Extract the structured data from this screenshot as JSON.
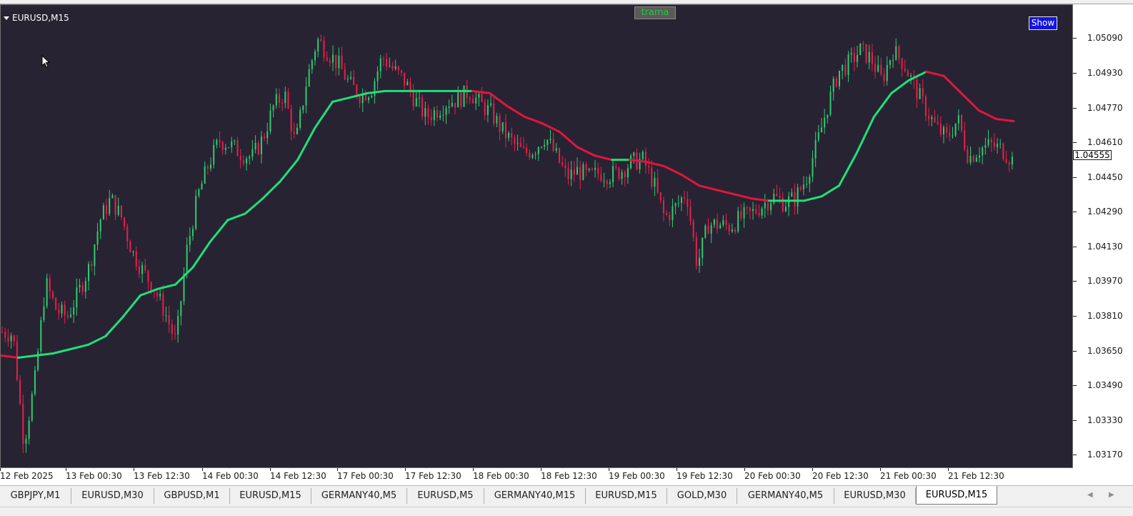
{
  "chart": {
    "symbol_title": "EURUSD,M15",
    "indicator_label": "trama",
    "show_button": "Show",
    "current_price": "1.04555",
    "colors": {
      "background": "#282332",
      "bull": "#2ecc71",
      "bear": "#e8204a",
      "ma_up": "#1ee07a",
      "ma_down": "#e0163f",
      "trama_text": "#21c93a",
      "show_bg": "#1414e0"
    }
  },
  "price_axis": [
    "1.05090",
    "1.04930",
    "1.04770",
    "1.04610",
    "1.04450",
    "1.04290",
    "1.04130",
    "1.03970",
    "1.03810",
    "1.03650",
    "1.03490",
    "1.03330",
    "1.03170"
  ],
  "time_axis": [
    "12 Feb 2025",
    "13 Feb 00:30",
    "13 Feb 12:30",
    "14 Feb 00:30",
    "14 Feb 12:30",
    "17 Feb 00:30",
    "17 Feb 12:30",
    "18 Feb 00:30",
    "18 Feb 12:30",
    "19 Feb 00:30",
    "19 Feb 12:30",
    "20 Feb 00:30",
    "20 Feb 12:30",
    "21 Feb 00:30",
    "21 Feb 12:30"
  ],
  "tabs": [
    "GBPJPY,M1",
    "EURUSD,M30",
    "GBPUSD,M1",
    "EURUSD,M15",
    "GERMANY40,M5",
    "EURUSD,M5",
    "GERMANY40,M15",
    "EURUSD,M15",
    "GOLD,M30",
    "GERMANY40,M5",
    "EURUSD,M30",
    "EURUSD,M15"
  ],
  "active_tab_index": 11,
  "chart_data": {
    "type": "line",
    "series_price": [
      1.0375,
      1.0374,
      1.0323,
      1.0352,
      1.0398,
      1.0385,
      1.0382,
      1.0393,
      1.0405,
      1.0427,
      1.0437,
      1.0428,
      1.0412,
      1.0403,
      1.0395,
      1.0384,
      1.037,
      1.0413,
      1.0438,
      1.0453,
      1.0464,
      1.0462,
      1.0458,
      1.0456,
      1.0465,
      1.048,
      1.0486,
      1.0462,
      1.0491,
      1.0511,
      1.0505,
      1.0499,
      1.049,
      1.0485,
      1.0488,
      1.0503,
      1.0497,
      1.0492,
      1.0483,
      1.0475,
      1.0478,
      1.0482,
      1.0483,
      1.0487,
      1.0481,
      1.0477,
      1.0469,
      1.0463,
      1.0458,
      1.046,
      1.0466,
      1.0457,
      1.0447,
      1.045,
      1.0447,
      1.0449,
      1.0448,
      1.045,
      1.0454,
      1.0455,
      1.0444,
      1.0428,
      1.0433,
      1.044,
      1.0406,
      1.0425,
      1.0425,
      1.0424,
      1.0428,
      1.043,
      1.0434,
      1.0438,
      1.0435,
      1.0437,
      1.0446,
      1.0462,
      1.048,
      1.0496,
      1.05,
      1.0506,
      1.0502,
      1.0492,
      1.0506,
      1.05,
      1.0489,
      1.0479,
      1.047,
      1.0465,
      1.0474,
      1.0456,
      1.046,
      1.0462,
      1.046,
      1.0455
    ],
    "series_trama": [
      1.0364,
      1.0363,
      1.0364,
      1.0365,
      1.0367,
      1.0369,
      1.0373,
      1.0382,
      1.0392,
      1.0395,
      1.0397,
      1.0405,
      1.0417,
      1.0427,
      1.043,
      1.0437,
      1.0445,
      1.0455,
      1.047,
      1.0482,
      1.0484,
      1.0486,
      1.0487,
      1.0487,
      1.0487,
      1.0487,
      1.0487,
      1.0487,
      1.0486,
      1.048,
      1.0475,
      1.0472,
      1.0468,
      1.0461,
      1.0457,
      1.0455,
      1.0455,
      1.0454,
      1.0452,
      1.0448,
      1.0443,
      1.0441,
      1.0439,
      1.0437,
      1.0436,
      1.0436,
      1.0436,
      1.0438,
      1.0443,
      1.0458,
      1.0475,
      1.0486,
      1.0492,
      1.0496,
      1.0494,
      1.0486,
      1.0478,
      1.0474,
      1.0473
    ],
    "ylim": [
      1.0312,
      1.0527
    ]
  }
}
